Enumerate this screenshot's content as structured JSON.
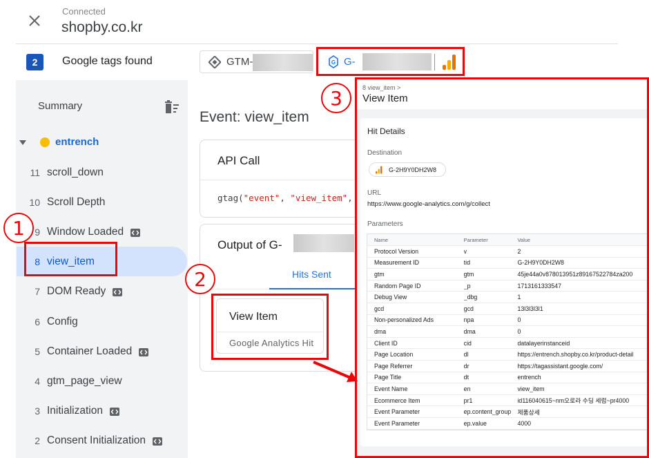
{
  "header": {
    "status": "Connected",
    "domain": "shopby.co.kr"
  },
  "tagbar": {
    "count": "2",
    "label": "Google tags found",
    "gtm_chip": "GTM-",
    "ga_chip": "G-"
  },
  "sidebar": {
    "summary_label": "Summary",
    "container_name": "entrench",
    "events": [
      {
        "num": "11",
        "name": "scroll_down",
        "code": false
      },
      {
        "num": "10",
        "name": "Scroll Depth",
        "code": false
      },
      {
        "num": "9",
        "name": "Window Loaded",
        "code": true
      },
      {
        "num": "8",
        "name": "view_item",
        "code": false,
        "selected": true
      },
      {
        "num": "7",
        "name": "DOM Ready",
        "code": true
      },
      {
        "num": "6",
        "name": "Config",
        "code": false
      },
      {
        "num": "5",
        "name": "Container Loaded",
        "code": true
      },
      {
        "num": "4",
        "name": "gtm_page_view",
        "code": false
      },
      {
        "num": "3",
        "name": "Initialization",
        "code": true
      },
      {
        "num": "2",
        "name": "Consent Initialization",
        "code": true
      }
    ]
  },
  "main": {
    "event_title": "Event: view_item",
    "api_card": {
      "title": "API Call",
      "code_prefix": "gtag(",
      "code_arg1": "\"event\"",
      "code_sep": ", ",
      "code_arg2": "\"view_item\"",
      "code_suffix": ", {"
    },
    "output_card": {
      "title": "Output of G-",
      "tab_label": "Hits Sent"
    },
    "hit_card": {
      "title": "View Item",
      "subtitle": "Google Analytics Hit"
    }
  },
  "detail": {
    "breadcrumb": "8 view_item >",
    "title": "View Item",
    "hit_details_label": "Hit Details",
    "destination_label": "Destination",
    "destination_value": "G-2H9Y0DH2W8",
    "url_label": "URL",
    "url_value": "https://www.google-analytics.com/g/collect",
    "parameters_label": "Parameters",
    "table_headers": [
      "Name",
      "Parameter",
      "Value"
    ],
    "rows": [
      [
        "Protocol Version",
        "v",
        "2"
      ],
      [
        "Measurement ID",
        "tid",
        "G-2H9Y0DH2W8"
      ],
      [
        "gtm",
        "gtm",
        "45je44a0v878013951z89167522784za200"
      ],
      [
        "Random Page ID",
        "_p",
        "1713161333547"
      ],
      [
        "Debug View",
        "_dbg",
        "1"
      ],
      [
        "gcd",
        "gcd",
        "13l3l3l3l1"
      ],
      [
        "Non-personalized Ads",
        "npa",
        "0"
      ],
      [
        "dma",
        "dma",
        "0"
      ],
      [
        "Client ID",
        "cid",
        "datalayerinstanceid"
      ],
      [
        "Page Location",
        "dl",
        "https://entrench.shopby.co.kr/product-detail"
      ],
      [
        "Page Referrer",
        "dr",
        "https://tagassistant.google.com/"
      ],
      [
        "Page Title",
        "dt",
        "entrench"
      ],
      [
        "Event Name",
        "en",
        "view_item"
      ],
      [
        "Ecommerce Item",
        "pr1",
        "id116040615~nm오로라 수딩 세럼~pr4000"
      ],
      [
        "Event Parameter",
        "ep.content_group",
        "제품상세"
      ],
      [
        "Event Parameter",
        "ep.value",
        "4000"
      ]
    ]
  },
  "annotations": {
    "callout_1": "1",
    "callout_2": "2",
    "callout_3": "3"
  },
  "colors": {
    "accent": "#1a73e8",
    "annotation_red": "#e8080a",
    "selected_bg": "#d3e3fd",
    "container_dot": "#fbbc04"
  }
}
